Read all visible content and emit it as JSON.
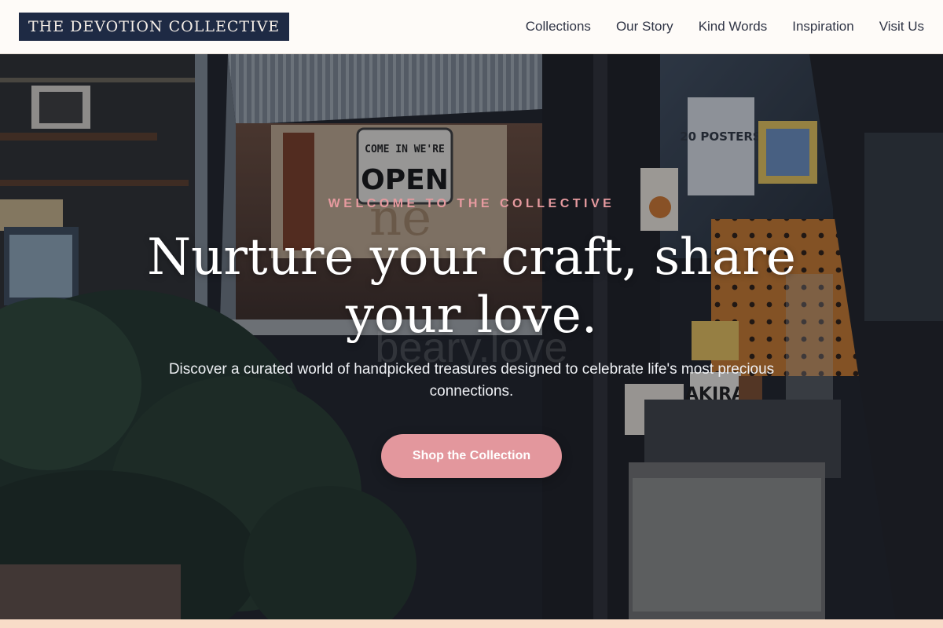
{
  "header": {
    "logo": "THE DEVOTION COLLECTIVE",
    "nav": [
      {
        "label": "Collections"
      },
      {
        "label": "Our Story"
      },
      {
        "label": "Kind Words"
      },
      {
        "label": "Inspiration"
      },
      {
        "label": "Visit Us"
      }
    ]
  },
  "hero": {
    "eyebrow": "WELCOME TO THE COLLECTIVE",
    "title": "Nurture your craft, share your love.",
    "subtitle": "Discover a curated world of handpicked treasures designed to celebrate life's most precious connections.",
    "cta_label": "Shop the Collection",
    "sign_text_1": "COME IN WE'RE",
    "sign_text_2": "OPEN",
    "poster_1": "20 POSTERS",
    "poster_2": "AKIRA",
    "window_lettering": "beary.love"
  },
  "colors": {
    "accent": "#e3979d",
    "eyebrow": "#e69a9f",
    "logo_bg": "#1e2a44",
    "header_bg": "#fefbf8",
    "bottom_strip": "#f8dcc8"
  }
}
